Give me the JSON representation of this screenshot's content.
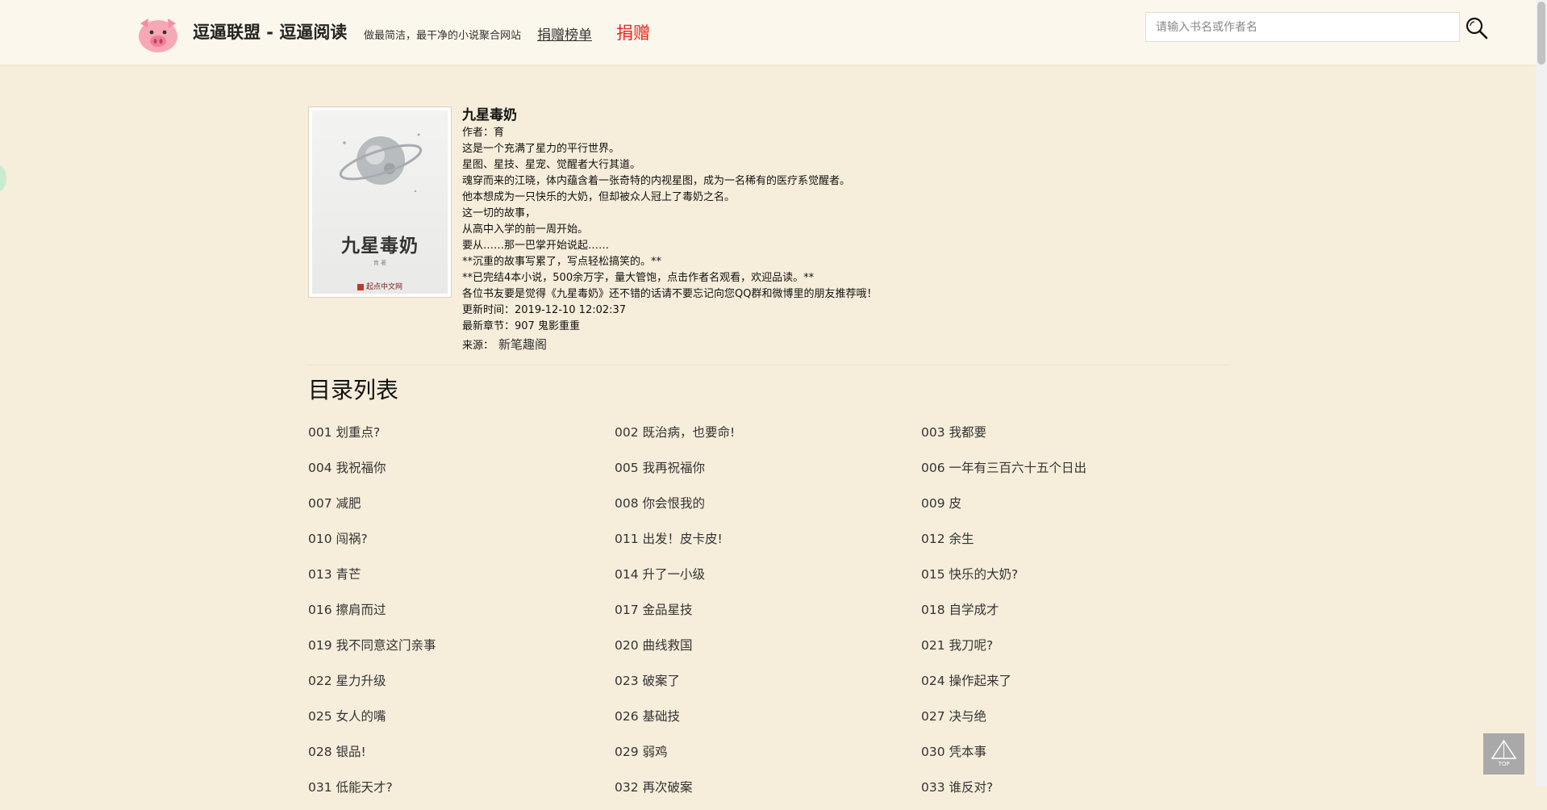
{
  "header": {
    "site_title": "逗逼联盟 - 逗逼阅读",
    "slogan": "做最简洁，最干净的小说聚合网站",
    "rank_link": "捐赠榜单",
    "donate_link": "捐赠",
    "search_placeholder": "请输入书名或作者名"
  },
  "book": {
    "cover_title": "九星毒奶",
    "cover_author": "育 著",
    "cover_publisher": "起点中文网",
    "title": "九星毒奶",
    "author_line": "作者：育",
    "description": [
      "这是一个充满了星力的平行世界。",
      "星图、星技、星宠、觉醒者大行其道。",
      "魂穿而来的江晓，体内蕴含着一张奇特的内视星图，成为一名稀有的医疗系觉醒者。",
      "他本想成为一只快乐的大奶，但却被众人冠上了毒奶之名。",
      "这一切的故事，",
      "从高中入学的前一周开始。",
      "要从……那一巴掌开始说起……",
      "**沉重的故事写累了，写点轻松搞笑的。**",
      "**已完结4本小说，500余万字，量大管饱，点击作者名观看，欢迎品读。**",
      "各位书友要是觉得《九星毒奶》还不错的话请不要忘记向您QQ群和微博里的朋友推荐哦！"
    ],
    "update_time": "更新时间：2019-12-10 12:02:37",
    "latest_chapter": "最新章节：907 鬼影重重",
    "source_label": "来源：",
    "source_name": "新笔趣阁"
  },
  "toc": {
    "heading": "目录列表",
    "chapters": [
      "001 划重点?",
      "002 既治病，也要命!",
      "003 我都要",
      "004 我祝福你",
      "005 我再祝福你",
      "006 一年有三百六十五个日出",
      "007 减肥",
      "008 你会恨我的",
      "009 皮",
      "010 闯祸?",
      "011 出发！皮卡皮!",
      "012 余生",
      "013 青芒",
      "014 升了一小级",
      "015 快乐的大奶?",
      "016 擦肩而过",
      "017 金品星技",
      "018 自学成才",
      "019 我不同意这门亲事",
      "020 曲线救国",
      "021 我刀呢?",
      "022 星力升级",
      "023 破案了",
      "024 操作起来了",
      "025 女人的嘴",
      "026 基础技",
      "027 决与绝",
      "028 银品!",
      "029 弱鸡",
      "030 凭本事",
      "031 低能天才?",
      "032 再次破案",
      "033 谁反对?"
    ]
  },
  "back_to_top": {
    "label": "TOP"
  }
}
